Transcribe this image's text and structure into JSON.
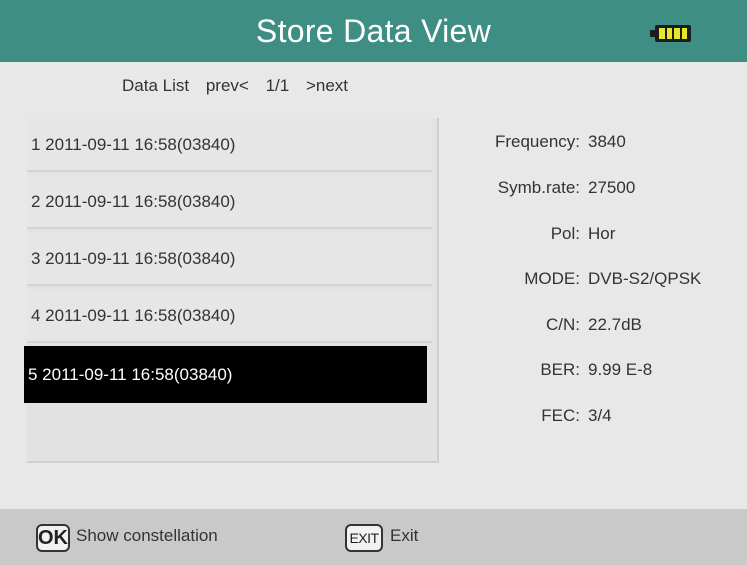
{
  "header": {
    "title": "Store Data View",
    "battery_icon": "battery-full-icon",
    "battery_color": "#e6e62a",
    "header_color": "#3f8e84"
  },
  "list_nav": {
    "label": "Data List",
    "prev": "prev<",
    "page": "1/1",
    "next": ">next"
  },
  "records": [
    "1 2011-09-11 16:58(03840)",
    "2 2011-09-11 16:58(03840)",
    "3 2011-09-11 16:58(03840)",
    "4 2011-09-11 16:58(03840)",
    "5 2011-09-11 16:58(03840)"
  ],
  "selected_index": 4,
  "details": [
    {
      "key": "Frequency:",
      "value": "3840"
    },
    {
      "key": "Symb.rate:",
      "value": "27500"
    },
    {
      "key": "Pol:",
      "value": "Hor"
    },
    {
      "key": "MODE:",
      "value": "DVB-S2/QPSK"
    },
    {
      "key": "C/N:",
      "value": "22.7dB"
    },
    {
      "key": "BER:",
      "value": "9.99 E-8"
    },
    {
      "key": "FEC:",
      "value": "3/4"
    }
  ],
  "footer": {
    "ok_key": "OK",
    "ok_label": "Show constellation",
    "exit_key": "EXIT",
    "exit_label": "Exit"
  }
}
